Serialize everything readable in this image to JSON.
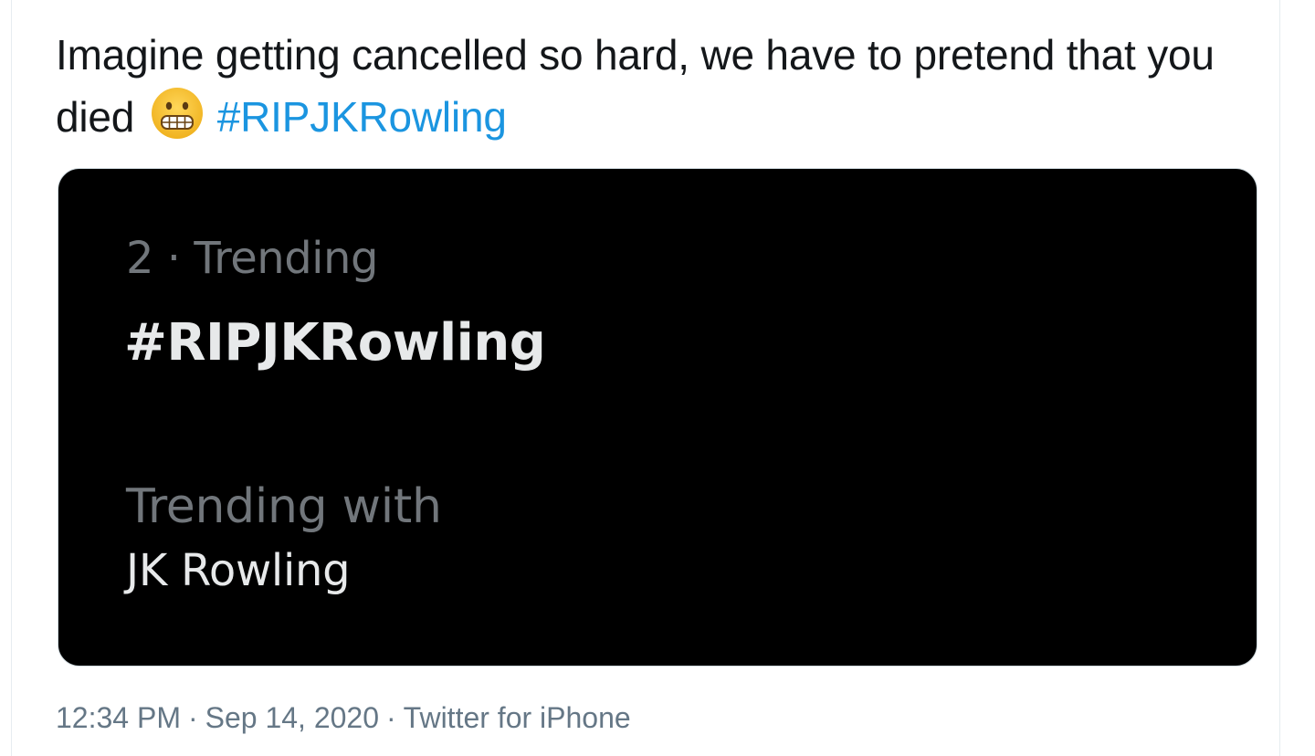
{
  "tweet": {
    "text_part1": "Imagine getting cancelled so hard, we have to pretend that you died",
    "emoji": "grimacing-face-emoji",
    "hashtag": "#RIPJKRowling"
  },
  "media_card": {
    "rank_line": "2 · Trending",
    "topic": "#RIPJKRowling",
    "trending_with_label": "Trending with",
    "trending_with_value": "JK Rowling"
  },
  "meta": {
    "time": "12:34 PM",
    "separator": "·",
    "date": "Sep 14, 2020",
    "source": "Twitter for iPhone"
  },
  "colors": {
    "link": "#1b95e0",
    "text": "#14171a",
    "meta": "#657786",
    "card_background": "#000000",
    "card_secondary_text": "#71767b",
    "card_primary_text": "#e7e9ea",
    "emoji_face": "#f5be2a"
  }
}
